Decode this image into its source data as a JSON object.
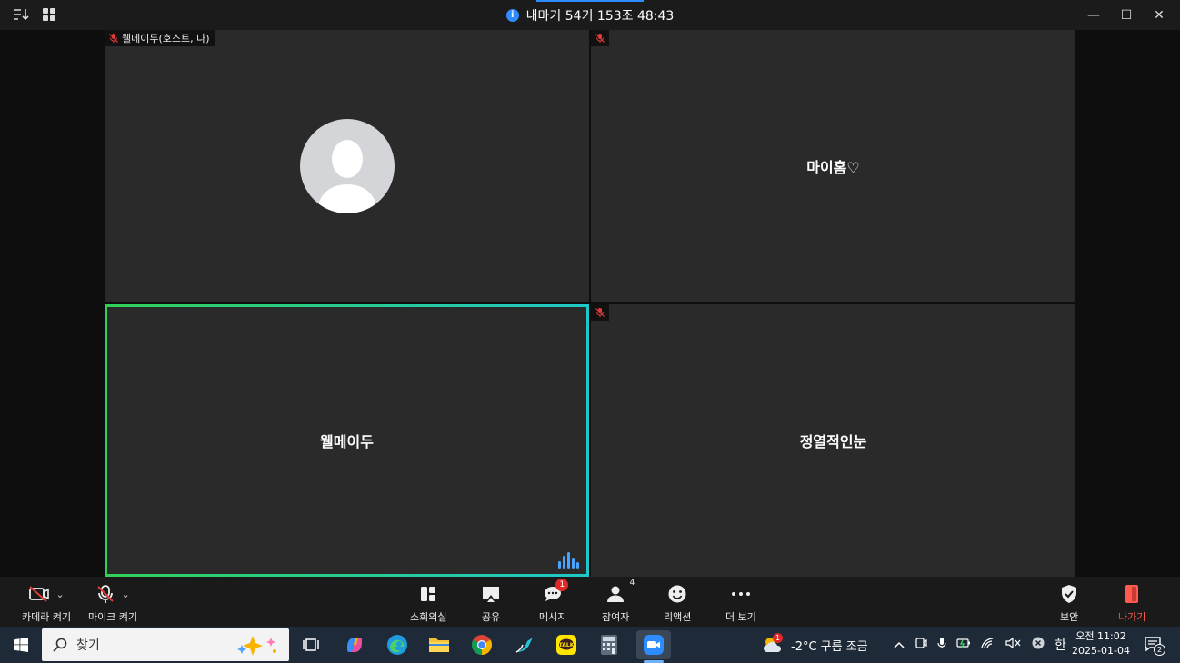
{
  "titlebar": {
    "meeting_info": "내마기 54기 153조 48:43",
    "minimize": "—",
    "maximize": "☐",
    "close": "✕"
  },
  "tiles": [
    {
      "label": "웰메이두(호스트, 나)",
      "name": ""
    },
    {
      "label": "",
      "name": "마이홈♡"
    },
    {
      "label": "",
      "name": "웰메이두"
    },
    {
      "label": "",
      "name": "정열적인눈"
    }
  ],
  "toolbar": {
    "camera_label": "카메라 켜기",
    "mic_label": "마이크 켜기",
    "breakout_label": "소회의실",
    "share_label": "공유",
    "chat_label": "메시지",
    "chat_badge": "1",
    "participants_label": "참여자",
    "participants_count": "4",
    "reactions_label": "리액션",
    "more_label": "더 보기",
    "security_label": "보안",
    "leave_label": "나가기",
    "leave_color": "#ff5a4f"
  },
  "taskbar": {
    "search_placeholder": "찾기",
    "weather_badge": "1",
    "weather_text": "-2°C 구름 조금",
    "ime": "한",
    "time": "오전 11:02",
    "date": "2025-01-04",
    "notification_count": "2"
  }
}
